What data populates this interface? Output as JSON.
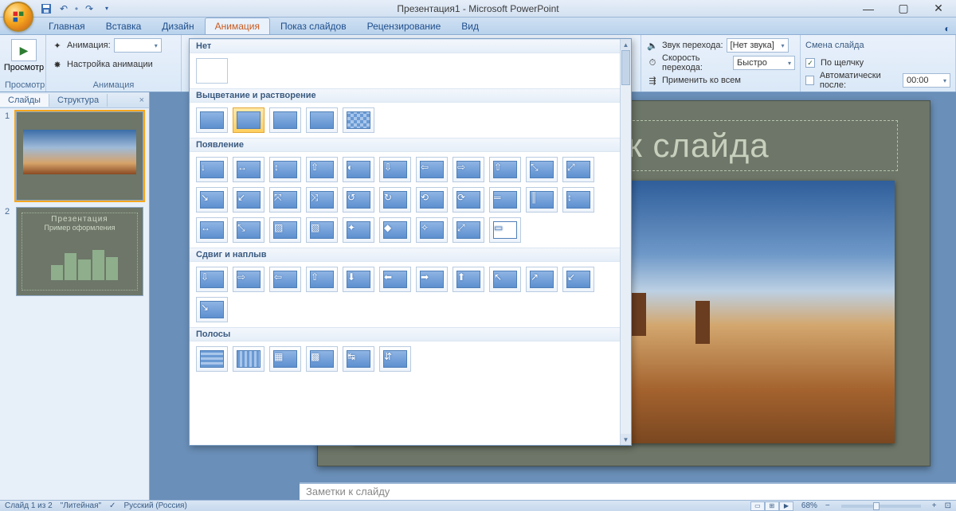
{
  "window": {
    "title": "Презентация1 - Microsoft PowerPoint"
  },
  "ribbon": {
    "tabs": [
      "Главная",
      "Вставка",
      "Дизайн",
      "Анимация",
      "Показ слайдов",
      "Рецензирование",
      "Вид"
    ],
    "active_tab_index": 3,
    "groups": {
      "preview": {
        "button": "Просмотр",
        "label": "Просмотр"
      },
      "animation": {
        "anim_label": "Анимация:",
        "custom_anim": "Настройка анимации",
        "label": "Анимация"
      },
      "sound": {
        "sound_label": "Звук перехода:",
        "sound_value": "[Нет звука]",
        "speed_label": "Скорость перехода:",
        "speed_value": "Быстро",
        "apply_all": "Применить ко всем"
      },
      "advance": {
        "label": "Смена слайда",
        "on_click": "По щелчку",
        "auto_after": "Автоматически после:",
        "time": "00:00"
      }
    }
  },
  "gallery": {
    "sections": {
      "none": "Нет",
      "fade": "Выцветание и растворение",
      "appear": "Появление",
      "push": "Сдвиг и наплыв",
      "stripes": "Полосы"
    }
  },
  "slide_panel": {
    "tabs": [
      "Слайды",
      "Структура"
    ],
    "thumbs": [
      {
        "num": "1"
      },
      {
        "num": "2",
        "title": "Презентация",
        "subtitle": "Пример оформления"
      }
    ]
  },
  "slide": {
    "title_placeholder": "Заголовок слайда"
  },
  "notes": {
    "placeholder": "Заметки к слайду"
  },
  "status": {
    "slide_of": "Слайд 1 из 2",
    "theme": "\"Литейная\"",
    "lang": "Русский (Россия)",
    "zoom": "68%"
  }
}
